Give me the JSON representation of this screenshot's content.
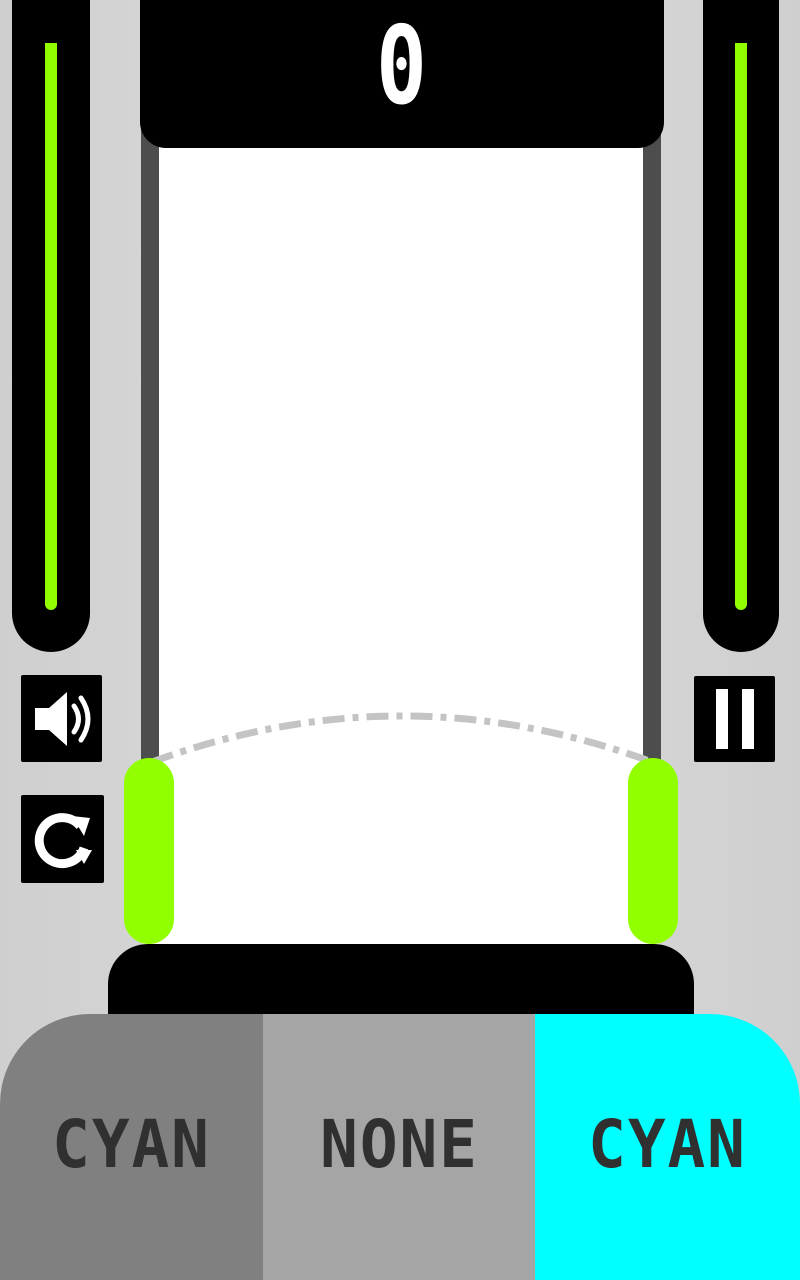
{
  "score": "0",
  "meters": {
    "left_level": 0.93,
    "right_level": 0.93,
    "fill_color": "#92ff00"
  },
  "controls": {
    "sound_icon": "speaker-volume-icon",
    "restart_icon": "restart-arrow-icon",
    "pause_icon": "pause-icon"
  },
  "paddle_color": "#92ff00",
  "selector": {
    "left_label": "CYAN",
    "middle_label": "NONE",
    "right_label": "CYAN"
  }
}
